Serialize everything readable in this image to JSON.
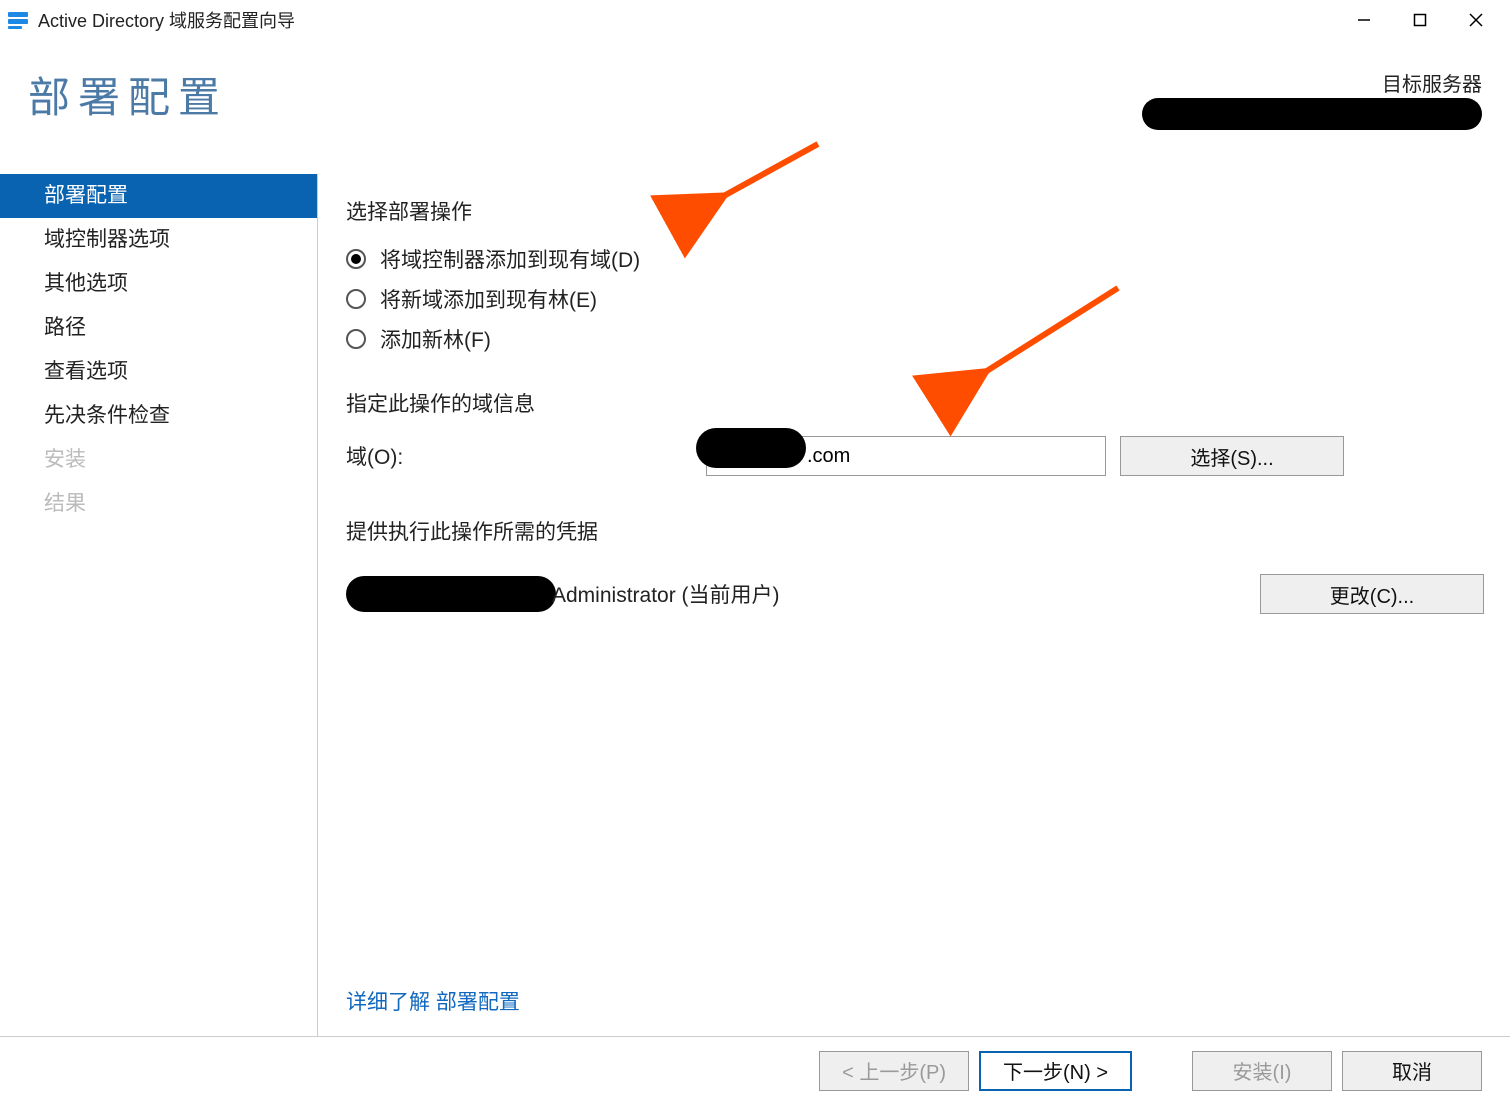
{
  "titlebar": {
    "icon_name": "server-manager-icon",
    "title": "Active Directory 域服务配置向导"
  },
  "header": {
    "page_title": "部署配置",
    "target_label": "目标服务器",
    "target_value_redacted": true
  },
  "sidebar": {
    "items": [
      {
        "label": "部署配置",
        "state": "selected"
      },
      {
        "label": "域控制器选项",
        "state": "normal"
      },
      {
        "label": "其他选项",
        "state": "normal"
      },
      {
        "label": "路径",
        "state": "normal"
      },
      {
        "label": "查看选项",
        "state": "normal"
      },
      {
        "label": "先决条件检查",
        "state": "normal"
      },
      {
        "label": "安装",
        "state": "disabled"
      },
      {
        "label": "结果",
        "state": "disabled"
      }
    ]
  },
  "content": {
    "choose_operation_title": "选择部署操作",
    "radios": [
      {
        "label": "将域控制器添加到现有域(D)",
        "selected": true
      },
      {
        "label": "将新域添加到现有林(E)",
        "selected": false
      },
      {
        "label": "添加新林(F)",
        "selected": false
      }
    ],
    "domain_info_title": "指定此操作的域信息",
    "domain_label": "域(O):",
    "domain_value_visible_suffix": ".com",
    "select_button": "选择(S)...",
    "credentials_title": "提供执行此操作所需的凭据",
    "credentials_text_suffix": "Administrator (当前用户)",
    "change_button": "更改(C)...",
    "more_link_prefix": "详细了解 ",
    "more_link_text": "部署配置"
  },
  "footer": {
    "prev": "< 上一步(P)",
    "next": "下一步(N) >",
    "install": "安装(I)",
    "cancel": "取消"
  },
  "annotations": {
    "arrow1": {
      "target": "radio-option-0"
    },
    "arrow2": {
      "target": "domain-input"
    }
  }
}
